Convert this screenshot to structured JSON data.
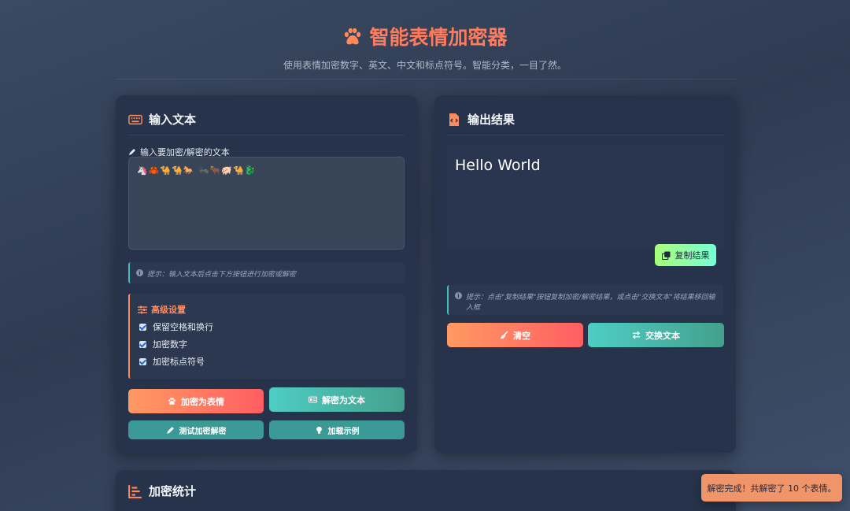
{
  "header": {
    "title": "智能表情加密器",
    "subtitle": "使用表情加密数字、英文、中文和标点符号。智能分类，一目了然。"
  },
  "input_panel": {
    "title": "输入文本",
    "field_label": "输入要加密/解密的文本",
    "textarea_value": "🦄🦀🐪🐪🐎 🐜🐂🐖🐪🐉",
    "hint": "提示：输入文本后点击下方按钮进行加密或解密",
    "advanced": {
      "title": "高级设置",
      "options": [
        {
          "label": "保留空格和换行",
          "checked": true
        },
        {
          "label": "加密数字",
          "checked": true
        },
        {
          "label": "加密标点符号",
          "checked": true
        }
      ]
    },
    "buttons": {
      "encrypt": "加密为表情",
      "decrypt": "解密为文本",
      "test": "测试加密解密",
      "example": "加载示例"
    }
  },
  "output_panel": {
    "title": "输出结果",
    "output_text": "Hello World",
    "copy_button": "复制结果",
    "hint": "提示：点击\"复制结果\"按钮复制加密/解密结果，或点击\"交换文本\"将结果移回输入框",
    "clear_button": "清空",
    "swap_button": "交换文本"
  },
  "stats_panel": {
    "title": "加密统计"
  },
  "toast": {
    "message": "解密完成！共解密了 10 个表情。"
  },
  "colors": {
    "accent": "#ff7b5c",
    "teal": "#4ecdc4",
    "panel": "#27334a"
  }
}
